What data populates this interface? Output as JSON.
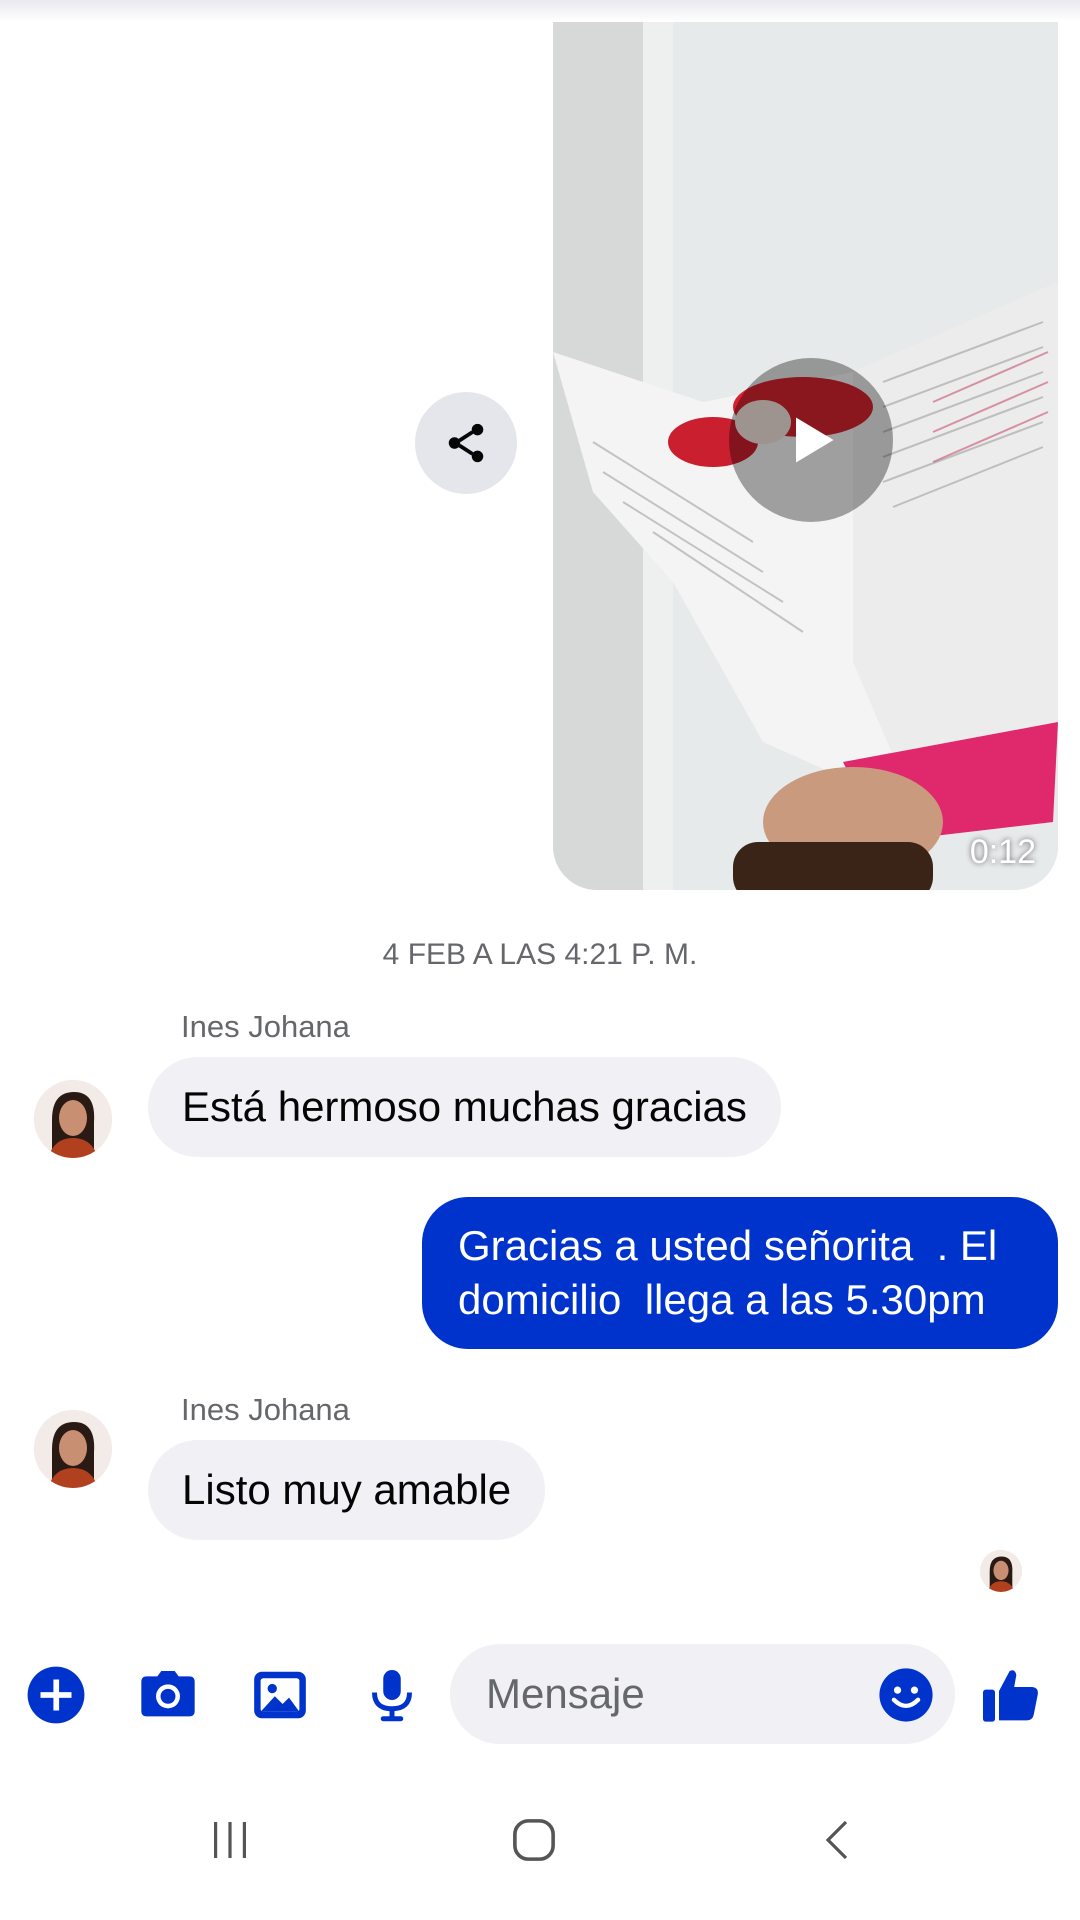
{
  "video_message": {
    "duration": "0:12",
    "play_icon": "play-icon",
    "share_icon": "share-icon"
  },
  "timestamp": "4 FEB A LAS 4:21 P. M.",
  "messages": [
    {
      "sender": "Ines Johana",
      "text": "Está hermoso muchas gracias",
      "direction": "incoming"
    },
    {
      "lines": [
        "Gracias a usted señorita  . El",
        "domicilio  llega a las 5.30pm"
      ],
      "direction": "outgoing"
    },
    {
      "sender": "Ines Johana",
      "text": "Listo muy amable",
      "direction": "incoming"
    }
  ],
  "composer": {
    "placeholder": "Mensaje",
    "icons": [
      "plus-circle-icon",
      "camera-icon",
      "image-icon",
      "microphone-icon",
      "emoji-icon",
      "thumbs-up-icon"
    ]
  },
  "colors": {
    "accent": "#0033cc",
    "incoming_bubble": "#f0f0f5",
    "secondary_text": "#65676b"
  },
  "navigation_bar": {
    "icons": [
      "recent-apps-icon",
      "home-icon",
      "back-icon"
    ]
  }
}
